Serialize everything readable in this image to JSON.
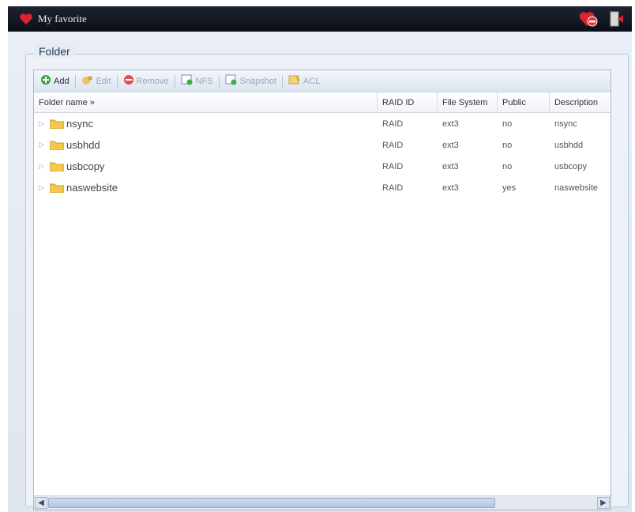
{
  "titlebar": {
    "title": "My favorite"
  },
  "panel": {
    "legend": "Folder"
  },
  "toolbar": {
    "add": "Add",
    "edit": "Edit",
    "remove": "Remove",
    "nfs": "NFS",
    "snapshot": "Snapshot",
    "acl": "ACL"
  },
  "columns": {
    "name": "Folder name »",
    "raid": "RAID ID",
    "fs": "File System",
    "public": "Public",
    "desc": "Description"
  },
  "rows": [
    {
      "name": "nsync",
      "raid": "RAID",
      "fs": "ext3",
      "public": "no",
      "desc": "nsync"
    },
    {
      "name": "usbhdd",
      "raid": "RAID",
      "fs": "ext3",
      "public": "no",
      "desc": "usbhdd"
    },
    {
      "name": "usbcopy",
      "raid": "RAID",
      "fs": "ext3",
      "public": "no",
      "desc": "usbcopy"
    },
    {
      "name": "naswebsite",
      "raid": "RAID",
      "fs": "ext3",
      "public": "yes",
      "desc": "naswebsite"
    }
  ],
  "colors": {
    "titlebar": "#0b0f18",
    "accent": "#d9232f",
    "panel": "#e6ecf4"
  }
}
